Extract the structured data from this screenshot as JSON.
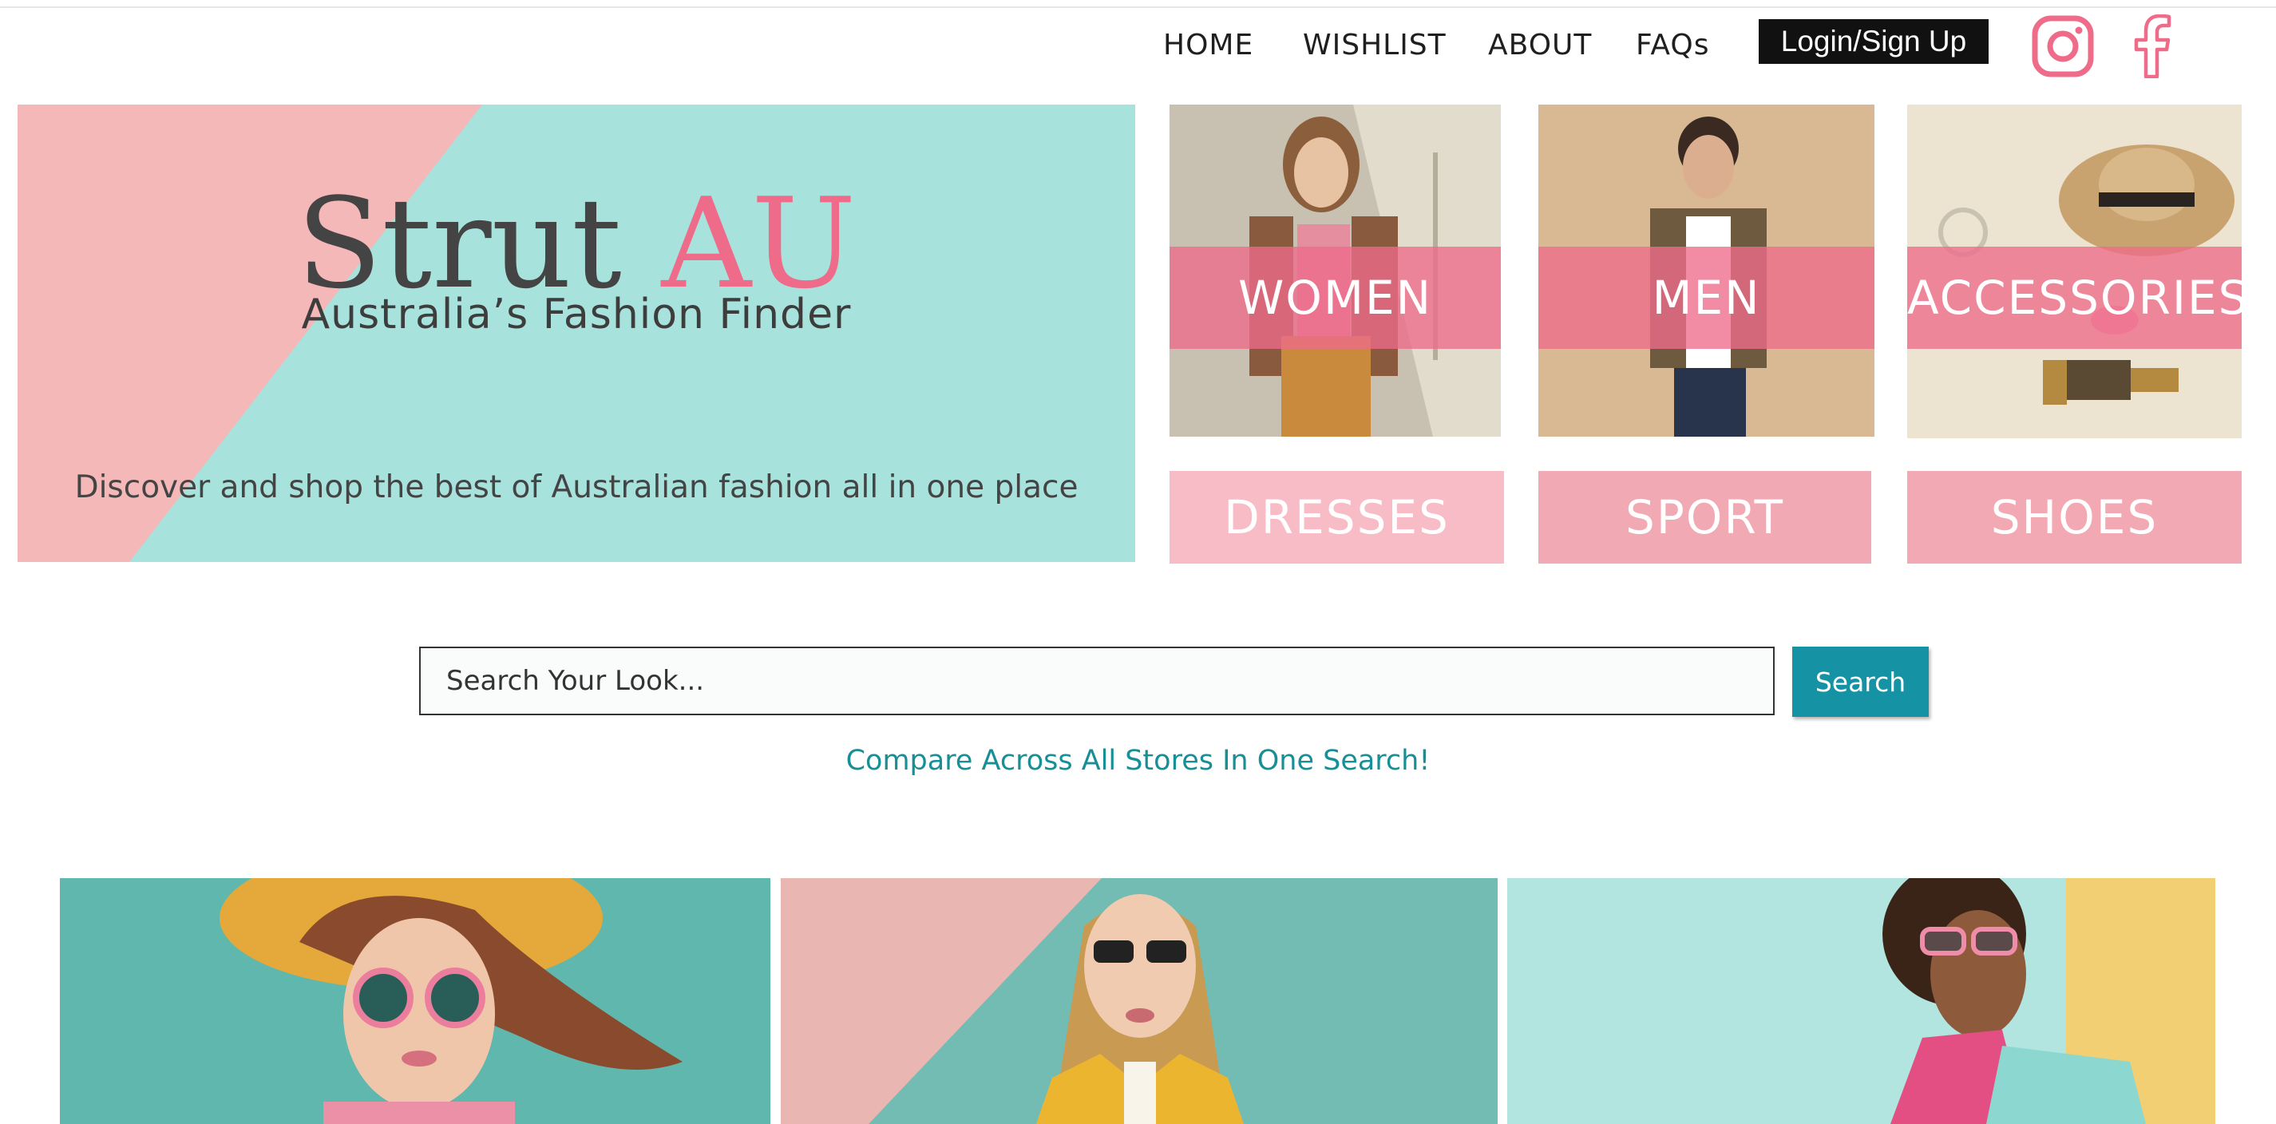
{
  "nav": {
    "home": "HOME",
    "wishlist": "WISHLIST",
    "about": "ABOUT",
    "faqs": "FAQs",
    "login": "Login/Sign Up",
    "instagram_icon": "instagram-icon",
    "facebook_icon": "facebook-icon"
  },
  "hero": {
    "title_main": "Strut",
    "title_accent": "AU",
    "subtitle": "Australia’s Fashion Finder",
    "tagline": "Discover and shop the best of Australian fashion all in one place"
  },
  "categories": {
    "women": "WOMEN",
    "men": "MEN",
    "accessories": "ACCESSORIES",
    "dresses": "DRESSES",
    "sport": "SPORT",
    "shoes": "SHOES"
  },
  "search": {
    "placeholder": "Search Your Look...",
    "button": "Search",
    "compare": "Compare Across All Stores In One Search!"
  },
  "colors": {
    "pink": "#ee6c8a",
    "teal": "#a8e2dd",
    "button_teal": "#1592a4"
  }
}
